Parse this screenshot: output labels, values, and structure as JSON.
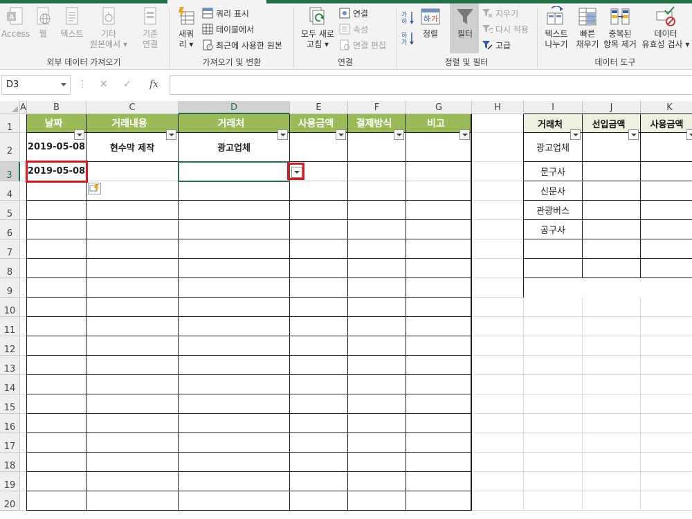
{
  "ribbon": {
    "groups": [
      {
        "label": "외부 데이터 가져오기"
      },
      {
        "label": "가져오기 및 변환"
      },
      {
        "label": "연결"
      },
      {
        "label": "정렬 및 필터"
      },
      {
        "label": "데이터 도구"
      }
    ],
    "external": {
      "access": "Access",
      "web": "웹",
      "text": "텍스트",
      "other_1": "기타",
      "other_2": "원본에서",
      "existing_1": "기존",
      "existing_2": "연결"
    },
    "transform": {
      "new_query_1": "새쿼",
      "new_query_2": "리",
      "show_queries": "쿼리 표시",
      "from_table": "테이블에서",
      "recent_sources": "최근에 사용한 원본"
    },
    "connections": {
      "refresh_1": "모두 새로",
      "refresh_2": "고침",
      "connections": "연결",
      "properties": "속성",
      "edit_links": "연결 편집"
    },
    "sort_filter": {
      "sort": "정렬",
      "filter": "필터",
      "clear": "지우기",
      "reapply": "다시 적용",
      "advanced": "고급"
    },
    "tools": {
      "text_to_columns_1": "텍스트",
      "text_to_columns_2": "나누기",
      "flash_fill_1": "빠른",
      "flash_fill_2": "채우기",
      "remove_dup_1": "중복된",
      "remove_dup_2": "항목 제거",
      "validation_1": "데이터",
      "validation_2": "유효성 검사"
    }
  },
  "formula_bar": {
    "name_box": "D3",
    "cancel": "✕",
    "enter": "✓",
    "fx": "fx",
    "value": ""
  },
  "columns": [
    "A",
    "B",
    "C",
    "D",
    "E",
    "F",
    "G",
    "H",
    "I",
    "J",
    "K"
  ],
  "rows": [
    "1",
    "2",
    "3",
    "4",
    "5",
    "6",
    "7",
    "8",
    "9",
    "10",
    "11",
    "12",
    "13",
    "14",
    "15",
    "16",
    "17",
    "18",
    "19",
    "20"
  ],
  "main_table": {
    "headers": [
      "날짜",
      "거래내용",
      "거래처",
      "사용금액",
      "결제방식",
      "비고"
    ],
    "rows": [
      [
        "2019-05-08",
        "현수막 제작",
        "광고업체",
        "",
        "",
        ""
      ],
      [
        "2019-05-08",
        "",
        "",
        "",
        "",
        ""
      ]
    ]
  },
  "side_table": {
    "headers": [
      "거래처",
      "선입금액",
      "사용금액"
    ],
    "rows": [
      "광고업체",
      "문구사",
      "신문사",
      "관광버스",
      "공구사",
      "",
      ""
    ]
  },
  "colors": {
    "header_green": "#9bbb59",
    "excel_green": "#217346",
    "highlight_red": "#e0141e"
  }
}
